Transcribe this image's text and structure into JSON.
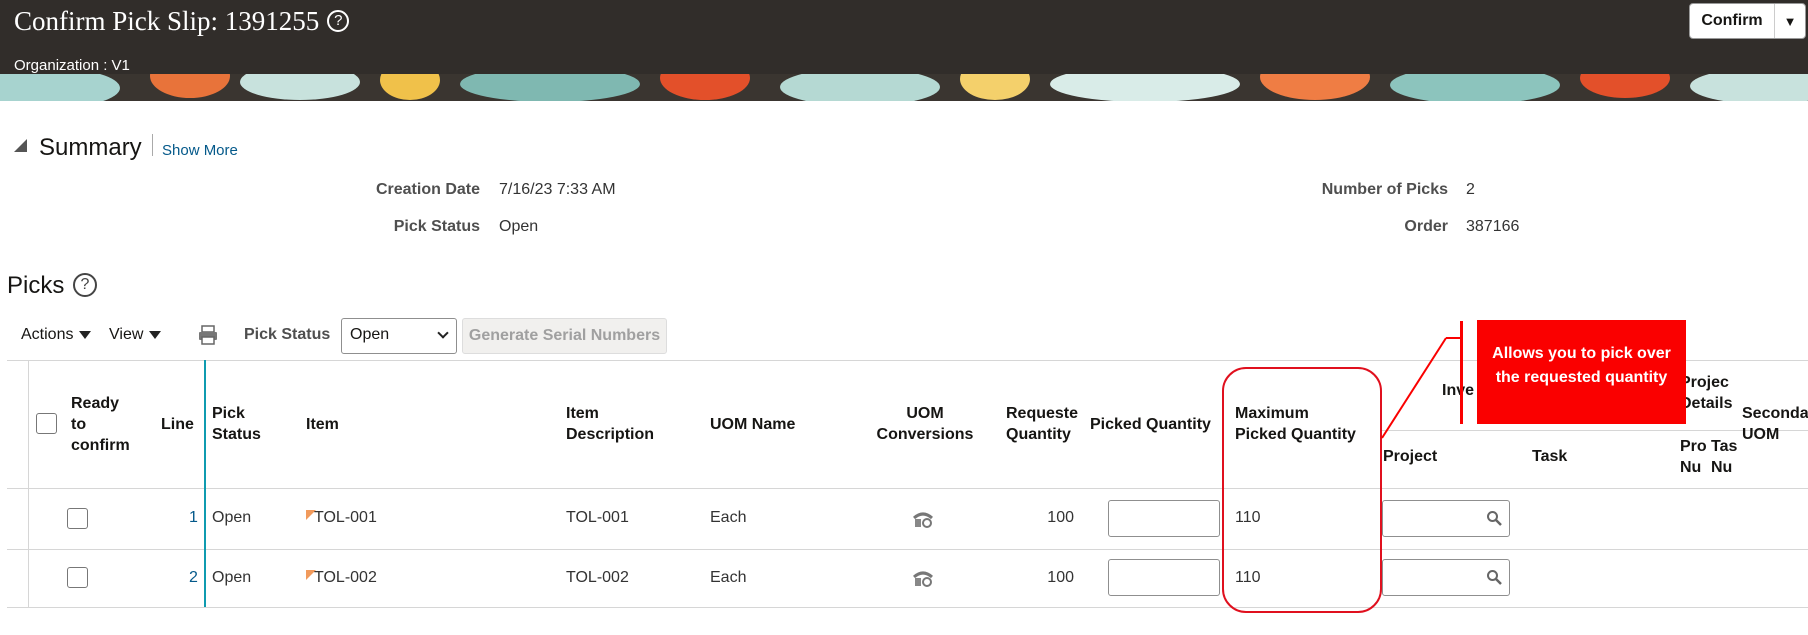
{
  "header": {
    "title": "Confirm Pick Slip: 1391255",
    "help_glyph": "?",
    "organization": "Organization : V1",
    "confirm_label": "Confirm"
  },
  "summary": {
    "title": "Summary",
    "show_more": "Show More",
    "fields": {
      "creation_date_label": "Creation Date",
      "creation_date_value": "7/16/23 7:33 AM",
      "pick_status_label": "Pick Status",
      "pick_status_value": "Open",
      "number_of_picks_label": "Number of Picks",
      "number_of_picks_value": "2",
      "order_label": "Order",
      "order_value": "387166"
    }
  },
  "picks": {
    "title": "Picks",
    "help_glyph": "?",
    "toolbar": {
      "actions_label": "Actions",
      "view_label": "View",
      "pick_status_label": "Pick Status",
      "pick_status_selected": "Open",
      "generate_serial_label": "Generate Serial Numbers"
    },
    "columns": {
      "ready_to_confirm": [
        "Ready",
        "to",
        "confirm"
      ],
      "line": "Line",
      "pick_status": [
        "Pick",
        "Status"
      ],
      "item": "Item",
      "item_description": [
        "Item",
        "Description"
      ],
      "uom_name": "UOM Name",
      "uom_conversions": [
        "UOM",
        "Conversions"
      ],
      "requested_quantity": [
        "Requeste",
        "Quantity"
      ],
      "picked_quantity": "Picked Quantity",
      "maximum_picked_quantity": [
        "Maximum",
        "Picked Quantity"
      ],
      "inventory_group": "Inve",
      "project": "Project",
      "task": "Task",
      "project_details_group": [
        "Projec",
        "Details"
      ],
      "project_number": [
        "Pro",
        "Nu"
      ],
      "task_number": [
        "Tas",
        "Nu"
      ],
      "secondary_uom": [
        "Seconda",
        "UOM"
      ]
    },
    "rows": [
      {
        "line": "1",
        "pick_status": "Open",
        "item": "TOL-001",
        "item_description": "TOL-001",
        "uom_name": "Each",
        "requested_quantity": "100",
        "picked_quantity": "",
        "maximum_picked_quantity": "110"
      },
      {
        "line": "2",
        "pick_status": "Open",
        "item": "TOL-002",
        "item_description": "TOL-002",
        "uom_name": "Each",
        "requested_quantity": "100",
        "picked_quantity": "",
        "maximum_picked_quantity": "110"
      }
    ]
  },
  "annotation": {
    "callout_text": [
      "Allows you to pick over",
      "the requested quantity"
    ],
    "callout_color": "#fa0000"
  },
  "colors": {
    "header_bg": "#312d2a",
    "link": "#04598a",
    "accent_line": "#0f9bb0"
  }
}
